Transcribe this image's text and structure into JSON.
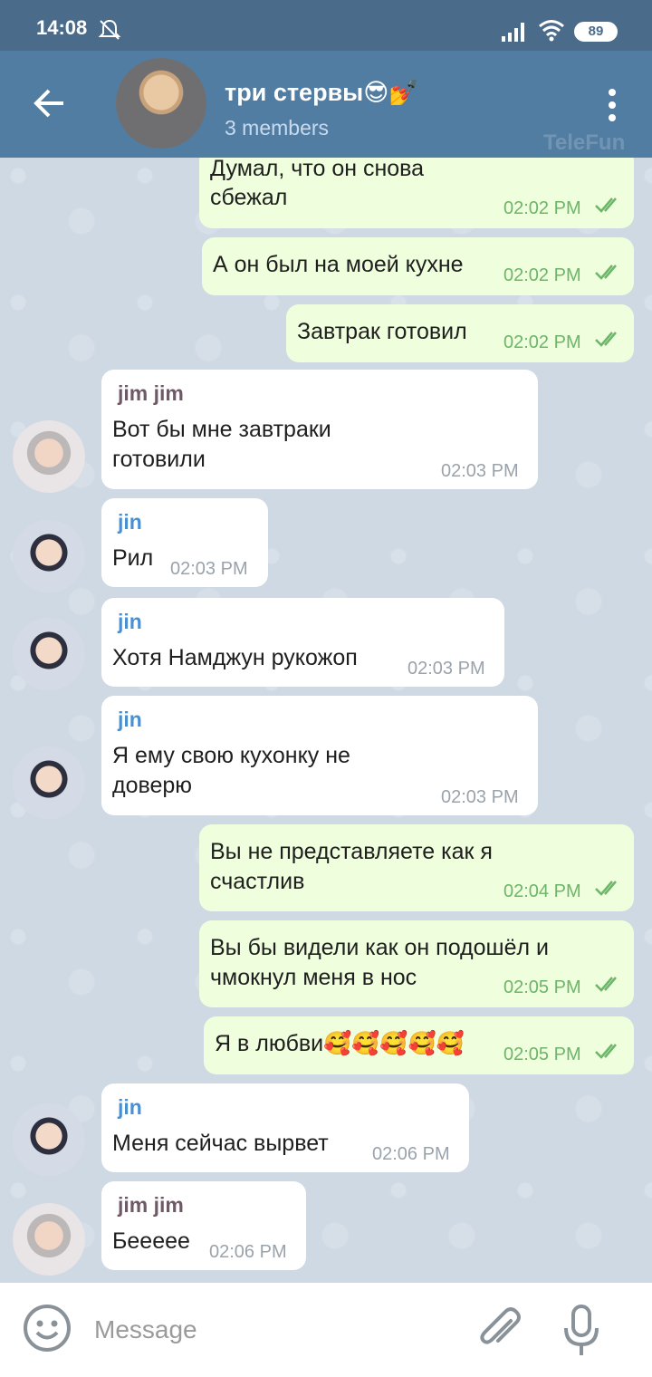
{
  "status_bar": {
    "time": "14:08",
    "battery": "89",
    "icons": [
      "mute-icon",
      "signal-icon",
      "wifi-icon",
      "battery-icon"
    ]
  },
  "header": {
    "title": "три стервы😎💅",
    "subtitle": "3 members",
    "watermark": "TeleFun",
    "colors": {
      "bar": "#527da3",
      "status_bar": "#4b6b8b"
    }
  },
  "messages": [
    {
      "dir": "out",
      "lines": [
        "Думал, что он снова",
        "сбежал"
      ],
      "time": "02:02 PM"
    },
    {
      "dir": "out",
      "lines": [
        "А он был на моей кухне"
      ],
      "time": "02:02 PM"
    },
    {
      "dir": "out",
      "lines": [
        "Завтрак готовил"
      ],
      "time": "02:02 PM"
    },
    {
      "dir": "in",
      "sender": "jim jim",
      "lines": [
        "Вот бы мне завтраки",
        "готовили"
      ],
      "time": "02:03 PM"
    },
    {
      "dir": "in",
      "sender": "jin",
      "lines": [
        "Рил"
      ],
      "time": "02:03 PM"
    },
    {
      "dir": "in",
      "sender": "jin",
      "lines": [
        "Хотя Намджун рукожоп"
      ],
      "time": "02:03 PM"
    },
    {
      "dir": "in",
      "sender": "jin",
      "lines": [
        "Я ему свою кухонку не",
        "доверю"
      ],
      "time": "02:03 PM"
    },
    {
      "dir": "out",
      "lines": [
        "Вы не представляете как я",
        "счастлив"
      ],
      "time": "02:04 PM"
    },
    {
      "dir": "out",
      "lines": [
        "Вы бы видели как он подошёл и",
        "чмокнул меня в нос"
      ],
      "time": "02:05 PM"
    },
    {
      "dir": "out",
      "lines": [
        "Я в любви🥰🥰🥰🥰🥰"
      ],
      "time": "02:05 PM"
    },
    {
      "dir": "in",
      "sender": "jin",
      "lines": [
        "Меня сейчас вырвет"
      ],
      "time": "02:06 PM"
    },
    {
      "dir": "in",
      "sender": "jim jim",
      "lines": [
        "Бееееe"
      ],
      "time": "02:06 PM"
    }
  ],
  "composer": {
    "placeholder": "Message",
    "icons": [
      "emoji-icon",
      "attach-icon",
      "mic-icon"
    ]
  },
  "colors": {
    "outgoing_bubble": "#effedd",
    "incoming_bubble": "#ffffff",
    "read_check": "#6db569",
    "sender_jim_jim": "#6e5a66",
    "sender_jin": "#4a8fd0"
  }
}
